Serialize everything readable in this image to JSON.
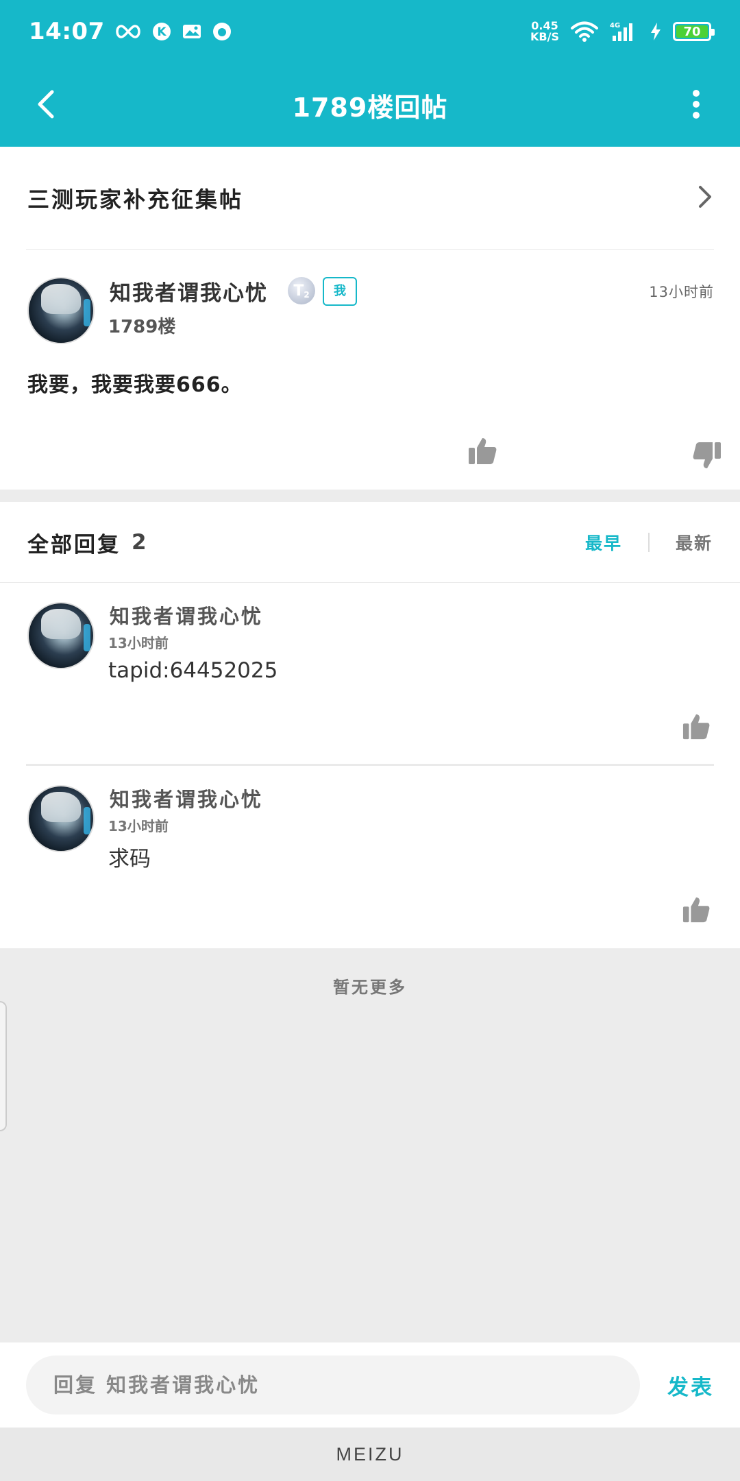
{
  "status_bar": {
    "time": "14:07",
    "speed_value": "0.45",
    "speed_unit": "KB/S",
    "network": "4G",
    "battery": "70",
    "icons": [
      "infinity-icon",
      "k-icon",
      "image-icon",
      "leaf-icon",
      "wifi-icon",
      "signal-icon",
      "charging-icon"
    ]
  },
  "appbar": {
    "title": "1789楼回帖"
  },
  "topic": {
    "title": "三测玩家补充征集帖"
  },
  "post": {
    "author": "知我者谓我心忧",
    "level_badge": "T",
    "level_sub": "2",
    "me_badge": "我",
    "time": "13小时前",
    "floor": "1789楼",
    "content": "我要，我要我要666。"
  },
  "replies_header": {
    "label": "全部回复",
    "count": "2",
    "sort_earliest": "最早",
    "sort_latest": "最新"
  },
  "replies": [
    {
      "author": "知我者谓我心忧",
      "time": "13小时前",
      "text": "tapid:64452025"
    },
    {
      "author": "知我者谓我心忧",
      "time": "13小时前",
      "text": "求码"
    }
  ],
  "no_more": "暂无更多",
  "input": {
    "placeholder": "回复 知我者谓我心忧",
    "publish": "发表"
  },
  "brand": "MEIZU",
  "colors": {
    "accent": "#16b8c9",
    "battery": "#4cd137"
  }
}
